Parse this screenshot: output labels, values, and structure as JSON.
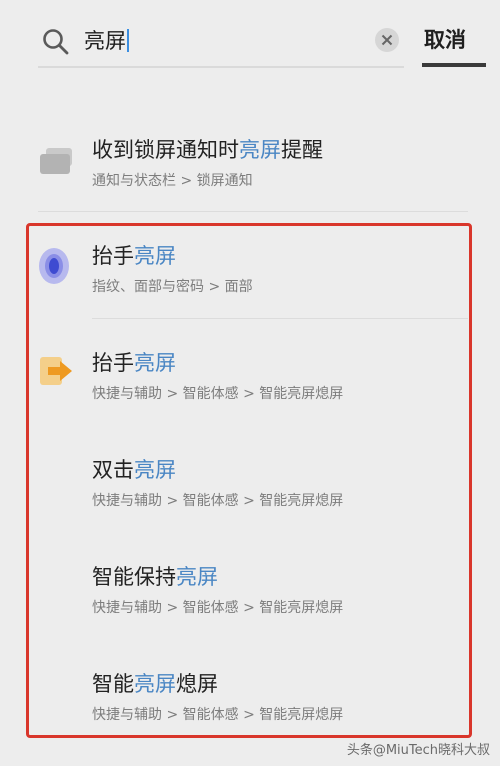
{
  "search": {
    "query": "亮屏",
    "cancel_label": "取消"
  },
  "results": [
    {
      "title_pre": "收到锁屏通知时",
      "title_hl": "亮屏",
      "title_post": "提醒",
      "path": "通知与状态栏 > 锁屏通知",
      "icon": "notification-icon"
    },
    {
      "title_pre": "抬手",
      "title_hl": "亮屏",
      "title_post": "",
      "path": "指纹、面部与密码 > 面部",
      "icon": "face-unlock-icon"
    },
    {
      "title_pre": "抬手",
      "title_hl": "亮屏",
      "title_post": "",
      "path": "快捷与辅助 > 智能体感 > 智能亮屏熄屏",
      "icon": "shortcut-arrow-icon"
    },
    {
      "title_pre": "双击",
      "title_hl": "亮屏",
      "title_post": "",
      "path": "快捷与辅助 > 智能体感 > 智能亮屏熄屏",
      "icon": ""
    },
    {
      "title_pre": "智能保持",
      "title_hl": "亮屏",
      "title_post": "",
      "path": "快捷与辅助 > 智能体感 > 智能亮屏熄屏",
      "icon": ""
    },
    {
      "title_pre": "智能",
      "title_hl": "亮屏",
      "title_post": "熄屏",
      "path": "快捷与辅助 > 智能体感 > 智能亮屏熄屏",
      "icon": ""
    }
  ],
  "watermark": "头条@MiuTech晓科大叔",
  "colors": {
    "highlight": "#4a86c4",
    "box": "#d9362b",
    "background": "#ededed"
  }
}
